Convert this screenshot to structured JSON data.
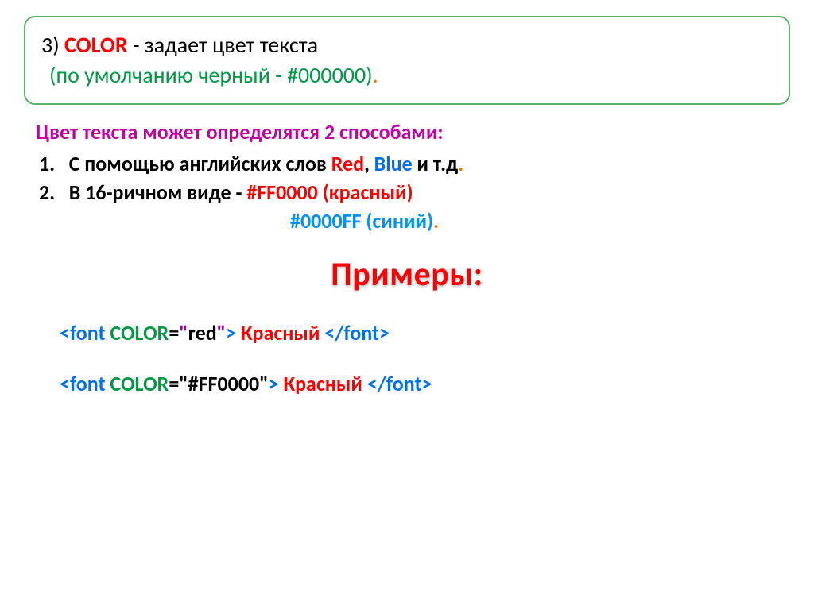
{
  "title": {
    "num": "3) ",
    "attr": "COLOR",
    "dash": " - ",
    "descr": "задает цвет текста",
    "line2_open": "(",
    "line2_text": "по умолчанию черный - #000000)",
    "line2_dot": "."
  },
  "body": {
    "intro": "Цвет текста может определятся 2 способами:",
    "item1_num": "1.",
    "item1_a": "   С помощью английских слов ",
    "item1_red": "Red",
    "item1_sep": ", ",
    "item1_blue": "Blue",
    "item1_etc": " и т.д",
    "item1_dot": ".",
    "item2_num": "2.",
    "item2_a": "   В 16-ричном виде - ",
    "item2_ff": "#FF0000 (красный)",
    "item3_ff": "#0000FF (синий)",
    "item3_dot": "."
  },
  "examples_heading": "Примеры:",
  "ex1": {
    "open_lt": "<",
    "tag1": "font",
    "sp1": " ",
    "attr": "COLOR",
    "eq": "=",
    "q1": "\"",
    "val": "red",
    "q2": "\"",
    "close_gt": ">",
    "content": " Красный ",
    "open_lt2": "</",
    "tag2": "font",
    "close_gt2": ">"
  },
  "ex2": {
    "open_lt": "<",
    "tag1": "font",
    "sp1": " ",
    "attr": "COLOR",
    "eq": "=",
    "q1": "\"",
    "val": "#FF0000",
    "q2": "\"",
    "close_gt": ">",
    "content": " Красный ",
    "open_lt2": "</",
    "tag2": "font",
    "close_gt2": ">"
  }
}
